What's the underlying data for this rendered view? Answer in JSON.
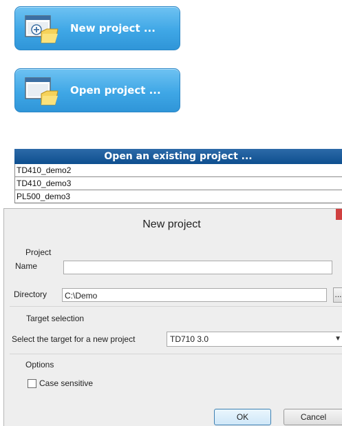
{
  "launcher": {
    "new_project_label": "New project ...",
    "open_project_label": "Open project ...",
    "new_project_icon": "new-project-folder-icon",
    "open_project_icon": "open-project-folder-icon"
  },
  "existing": {
    "header": "Open an existing project ...",
    "projects": [
      "TD410_demo2",
      "TD410_demo3",
      "PL500_demo3"
    ]
  },
  "dialog": {
    "title": "New project",
    "project_section": "Project",
    "name_label": "Name",
    "name_value": "",
    "directory_label": "Directory",
    "directory_value": "C:\\Demo",
    "browse_label": "...",
    "target_section": "Target selection",
    "target_label": "Select the target for a new project",
    "target_value": "TD710 3.0",
    "options_section": "Options",
    "case_sensitive_label": "Case sensitive",
    "case_sensitive_checked": false,
    "ok_label": "OK",
    "cancel_label": "Cancel"
  },
  "colors": {
    "button_blue": "#3fa7e6",
    "header_blue": "#0e4f8f",
    "dialog_bg": "#eeeeee",
    "close_red": "#d04040"
  }
}
